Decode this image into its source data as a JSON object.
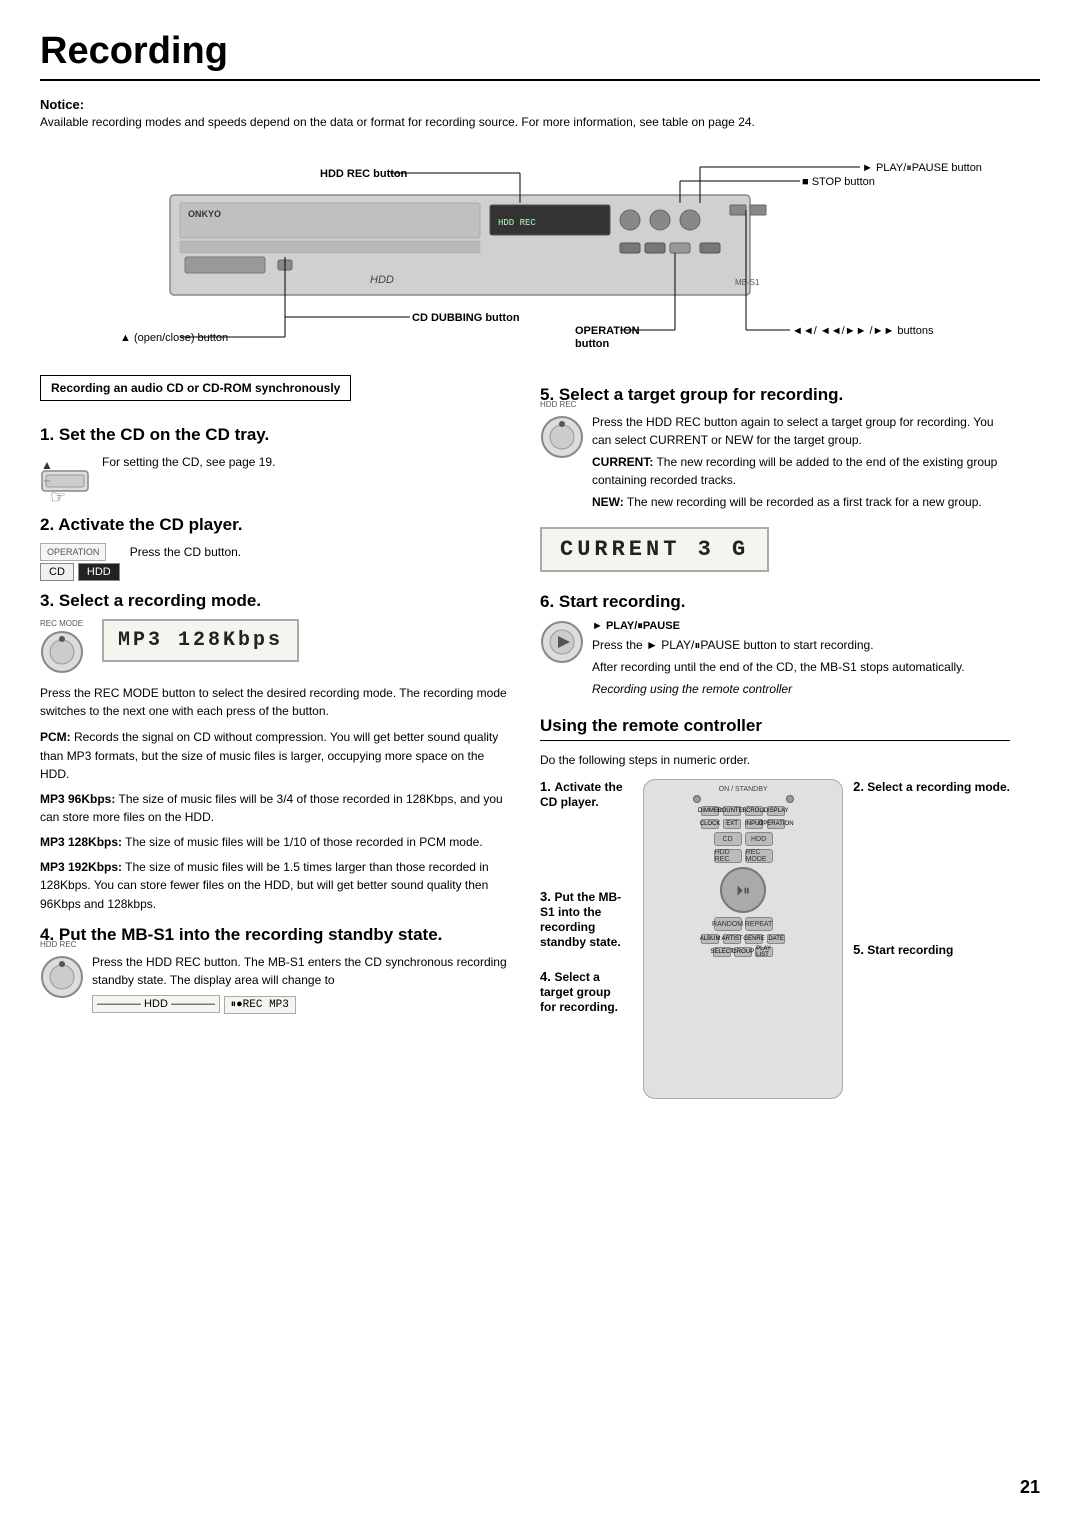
{
  "page": {
    "title": "Recording",
    "page_number": "21"
  },
  "notice": {
    "label": "Notice:",
    "text": "Available recording modes and speeds depend on the data or format for recording source. For more information, see table on page 24."
  },
  "diagram": {
    "labels": {
      "play_pause": "► PLAY/⏸PAUSE button",
      "hdd_rec": "HDD REC button",
      "stop": "■ STOP button",
      "cd_dubbing": "CD DUBBING button",
      "open_close": "▲ (open/close) button",
      "operation": "OPERATION button",
      "nav_buttons": "◄◄/ ◄◄/►► /►► buttons"
    }
  },
  "section_header": "Recording an audio CD or CD-ROM synchronously",
  "steps": {
    "step1": {
      "heading": "1. Set the CD on the CD tray.",
      "text": "For setting the CD, see page 19."
    },
    "step2": {
      "heading": "2. Activate the CD player.",
      "text": "Press the CD button.",
      "cd_label": "CD",
      "hdd_label": "HDD",
      "operation_label": "OPERATION"
    },
    "step3": {
      "heading": "3. Select a recording mode.",
      "rec_mode_label": "REC MODE",
      "display_value": "MP3 128Kbps",
      "text1": "Press the REC MODE button to select the desired recording mode. The recording mode switches to the next one with each press of the button.",
      "pcm_text": "PCM: Records the signal on CD without compression. You will get better sound quality than MP3 formats, but the size of music files is larger, occupying more space on the HDD.",
      "mp3_96_text": "MP3 96Kbps: The size of music files will be 3/4 of those recorded in 128Kbps, and you can store more files on the HDD.",
      "mp3_128_text": "MP3 128Kbps: The size of music files will be 1/10 of those recorded in PCM mode.",
      "mp3_192_text": "MP3 192Kbps: The size of music files will be 1.5 times larger than those recorded in 128Kbps. You can store fewer files on the HDD, but will get better sound quality then 96Kbps and 128kbps."
    },
    "step4": {
      "heading": "4. Put the MB-S1 into the recording standby state.",
      "hdd_rec_label": "HDD REC",
      "text": "Press the HDD REC button. The MB-S1 enters the CD synchronous recording standby state. The display area will change to",
      "display_value": "⏸●REC    MP3"
    },
    "step5": {
      "heading": "5. Select a target group for recording.",
      "hdd_rec_label": "HDD REC",
      "text1": "Press the HDD REC button again to select a target group for recording. You can select CURRENT or NEW for the target group.",
      "current_bold": "CURRENT:",
      "current_text": " The new recording will be added to the end of the existing group containing recorded tracks.",
      "new_bold": "NEW:",
      "new_text": " The new recording will be recorded as a first track for a new group.",
      "display_value": "CURRENT    3 G"
    },
    "step6": {
      "heading": "6. Start recording.",
      "play_pause_label": "► PLAY/⏸PAUSE",
      "text1": "Press the ► PLAY/⏸PAUSE button to start recording.",
      "text2": "After recording until the end of the CD, the MB-S1 stops automatically.",
      "text3": "Recording using the remote controller"
    }
  },
  "using_remote": {
    "heading": "Using the remote controller",
    "intro": "Do the following steps in numeric order.",
    "step1": {
      "num": "1.",
      "label": "Activate the CD player."
    },
    "step2": {
      "num": "2.",
      "label": "Select a recording mode."
    },
    "step3": {
      "num": "3.",
      "label": "Put the MB-S1 into the recording standby state."
    },
    "step4": {
      "num": "4.",
      "label": "Select a target group for recording."
    },
    "step5": {
      "num": "5.",
      "label": "Start recording"
    },
    "remote_buttons": {
      "on": "ON",
      "standby": "STANDBY",
      "dimmer": "DIMMER",
      "counter": "COUNTER",
      "scroll": "SCROLL",
      "display": "DISPLAY",
      "clock": "CLOCK",
      "ext": "EXT",
      "input": "INPUT",
      "operation": "OPERATION",
      "cd": "CD",
      "hdd": "HDD",
      "hdd_rec": "HDD REC",
      "rec_mode": "REC MODE",
      "random": "RANDOM",
      "repeat": "REPEAT",
      "album": "ALBUM",
      "artist": "ARTIST",
      "genre": "GENRE",
      "date": "DATE",
      "select": "SELECT",
      "group": "GROUP",
      "playlist": "PLAY LIST"
    }
  }
}
